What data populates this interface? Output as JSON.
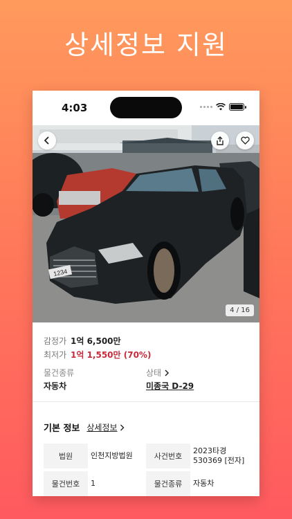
{
  "headline": "상세정보 지원",
  "status": {
    "time": "4:03"
  },
  "photo": {
    "counter": "4 / 16",
    "plate": "1234"
  },
  "prices": {
    "appraisal_label": "감정가",
    "appraisal_value": "1억 6,500만",
    "minimum_label": "최저가",
    "minimum_value": "1억 1,550만 (70%)"
  },
  "info": {
    "type_label": "물건종류",
    "type_value": "자동차",
    "state_label": "상태",
    "state_value": "미종국 D-29"
  },
  "basic": {
    "title": "기본 정보",
    "detail_link": "상세정보",
    "rows": [
      {
        "h1": "법원",
        "v1": "인천지방법원",
        "h2": "사건번호",
        "v2": "2023타경 530369 [전자]"
      },
      {
        "h1": "물건번호",
        "v1": "1",
        "h2": "물건종류",
        "v2": "자동차"
      }
    ]
  },
  "colors": {
    "accent_red": "#c62a3a",
    "bg_top": "#ff9a5c",
    "bg_bottom": "#ff5a5f"
  },
  "icons": [
    "back-icon",
    "share-icon",
    "heart-icon",
    "wifi-icon",
    "battery-icon",
    "chevron-right-icon"
  ]
}
